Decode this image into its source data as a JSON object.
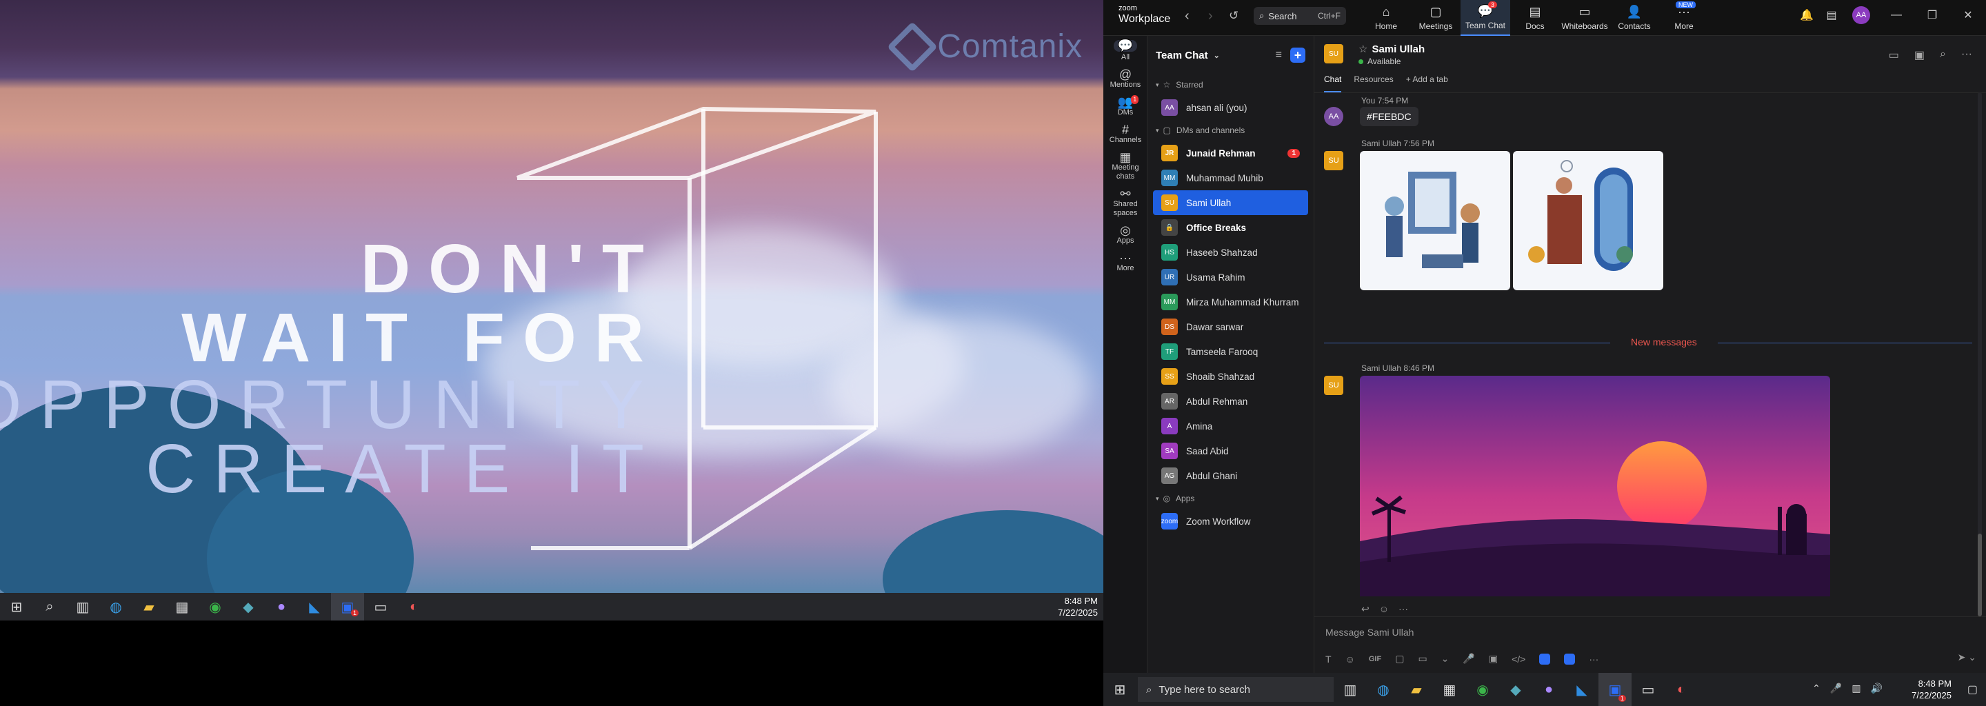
{
  "wallpaper": {
    "logo": "Comtanix",
    "quote_lines": [
      "DON'T",
      "WAIT FOR",
      "OPPORTUNITY",
      "CREATE IT"
    ]
  },
  "taskbar_left": {
    "icons": [
      "windows-start-icon",
      "search-icon",
      "task-view-icon",
      "edge-icon",
      "file-explorer-icon",
      "store-icon",
      "chrome-icon",
      "app-icon",
      "github-icon",
      "vscode-icon",
      "zoom-icon",
      "terminal-icon",
      "ssh-icon"
    ],
    "zoom_badge": "1",
    "time": "8:48 PM",
    "date": "7/22/2025"
  },
  "zoom": {
    "brand_top": "zoom",
    "brand_bottom": "Workplace",
    "search": {
      "label": "Search",
      "shortcut": "Ctrl+F"
    },
    "nav": [
      {
        "label": "Home",
        "icon": "⌂"
      },
      {
        "label": "Meetings",
        "icon": "▢"
      },
      {
        "label": "Team Chat",
        "icon": "💬",
        "badge": "3",
        "active": true
      },
      {
        "label": "Docs",
        "icon": "▤"
      },
      {
        "label": "Whiteboards",
        "icon": "▭"
      },
      {
        "label": "Contacts",
        "icon": "👤"
      },
      {
        "label": "More",
        "icon": "···",
        "new": "NEW"
      }
    ],
    "user_initials": "AA",
    "rail": [
      {
        "label": "All",
        "icon": "💬",
        "active": true
      },
      {
        "label": "Mentions",
        "icon": "@"
      },
      {
        "label": "DMs",
        "icon": "👥",
        "badge": "1"
      },
      {
        "label": "Channels",
        "icon": "#"
      },
      {
        "label": "Meeting chats",
        "icon": "▦"
      },
      {
        "label": "Shared spaces",
        "icon": "⚯"
      },
      {
        "label": "Apps",
        "icon": "◎"
      },
      {
        "label": "More",
        "icon": "···"
      }
    ],
    "chatlist": {
      "title": "Team Chat",
      "starred_label": "Starred",
      "starred": [
        {
          "initials": "AA",
          "name": "ahsan ali (you)",
          "color": "#7a4fa3"
        }
      ],
      "dms_label": "DMs and channels",
      "dms": [
        {
          "initials": "JR",
          "name": "Junaid Rehman",
          "color": "#e6a017",
          "bold": true,
          "count": "1"
        },
        {
          "initials": "MM",
          "name": "Muhammad Muhib",
          "color": "#2f7fb5"
        },
        {
          "initials": "SU",
          "name": "Sami Ullah",
          "color": "#e6a017",
          "selected": true
        },
        {
          "initials": "🔒",
          "name": "Office Breaks",
          "color": "#444",
          "bold": true
        },
        {
          "initials": "HS",
          "name": "Haseeb Shahzad",
          "color": "#1f9e7a"
        },
        {
          "initials": "UR",
          "name": "Usama Rahim",
          "color": "#2f6fb5"
        },
        {
          "initials": "MM",
          "name": "Mirza Muhammad Khurram",
          "color": "#2a9a5a"
        },
        {
          "initials": "DS",
          "name": "Dawar sarwar",
          "color": "#d0631c"
        },
        {
          "initials": "TF",
          "name": "Tamseela Farooq",
          "color": "#1f9e7a"
        },
        {
          "initials": "SS",
          "name": "Shoaib Shahzad",
          "color": "#e6a017"
        },
        {
          "initials": "AR",
          "name": "Abdul Rehman",
          "color": "#666"
        },
        {
          "initials": "A",
          "name": "Amina",
          "color": "#8a3bbf"
        },
        {
          "initials": "SA",
          "name": "Saad Abid",
          "color": "#a03bbf"
        },
        {
          "initials": "AG",
          "name": "Abdul Ghani",
          "color": "#777"
        }
      ],
      "apps_label": "Apps",
      "apps": [
        {
          "initials": "zoom",
          "name": "Zoom Workflow",
          "color": "#2d6df6"
        }
      ]
    },
    "chat": {
      "contact_initials": "SU",
      "contact_name": "Sami Ullah",
      "status": "Available",
      "tabs": [
        "Chat",
        "Resources",
        "+ Add a tab"
      ],
      "msg1_meta": "You 7:54 PM",
      "msg1_text": "#FEEBDC",
      "my_initials": "AA",
      "msg2_meta": "Sami Ullah 7:56 PM",
      "new_messages": "New messages",
      "msg3_meta": "Sami Ullah 8:46 PM",
      "composer_placeholder": "Message Sami Ullah",
      "composer_tools": [
        "T",
        "☺",
        "GIF",
        "▢",
        "▭",
        "⌄",
        "🎤",
        "▣",
        "</>"
      ]
    }
  },
  "taskbar_right": {
    "search_placeholder": "Type here to search",
    "zoom_badge": "1",
    "time": "8:48 PM",
    "date": "7/22/2025"
  }
}
